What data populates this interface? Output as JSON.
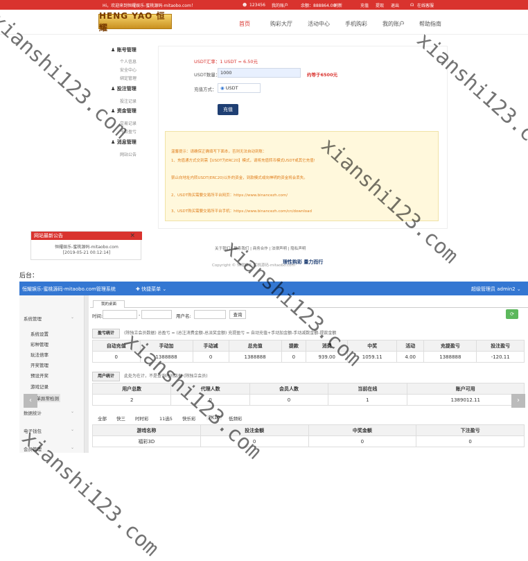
{
  "topbar": {
    "welcome": "Hi，欢迎来到恒耀娱乐-蜜桃源码-mitaobo.com！",
    "user": "123456",
    "account": "我的账户",
    "balance": "余额：888864.00",
    "refresh": "刷新",
    "recharge": "充值",
    "withdraw": "提现",
    "logout": "退出",
    "service": "在线客服"
  },
  "logo": {
    "text": "HENG YAO 恒耀"
  },
  "nav": [
    "首页",
    "购彩大厅",
    "活动中心",
    "手机购彩",
    "我的账户",
    "帮助指南"
  ],
  "sidebar": {
    "account_title": "账号管理",
    "account_items": [
      "个人信息",
      "安全中心",
      "绑定管理"
    ],
    "bet_title": "投注管理",
    "bet_items": [
      "投注记录"
    ],
    "funds_title": "资金管理",
    "funds_items": [
      "交易记录",
      "今日盈亏"
    ],
    "msg_title": "消息管理",
    "msg_items": [
      "网站公告"
    ]
  },
  "recharge": {
    "rate": "USDT汇率：1 USDT = 6.50元",
    "amount_label": "USDT数量：",
    "amount_value": "1000",
    "equiv": "约等于6500元",
    "method_label": "充值方式：",
    "method_value": "USDT",
    "submit": "充值"
  },
  "notice": {
    "l1": "温馨提示：请确保正确填写下面本，否则无法自动到账：",
    "l2": "1、充值通方式交到需【USDT为ERC20】模式，请将充值转币模式USDT或其它充值!",
    "l3": "禁止向地址内转USDT(ERC20)以外的资金，到款模式或向神明的资金将会丢失。",
    "l4": "2、USDT购买需要交易所平台网页：https://www.binancezh.com/",
    "l5": "3、USDT购买需要交易所平台手机：https://www.binancezh.com/cn/download"
  },
  "announce": {
    "title": "网站最新公告",
    "close": "×",
    "line1": "恒耀娱乐-蜜桃源码-mitaobo.com",
    "line2": "[2019-05-21 00:12:14]"
  },
  "footer": {
    "links": "关于我们 | 联系我们 | 商务合作 | 法律声明 | 隐私声明",
    "copyright": "Copyright © 恒耀娱乐-蜜桃源码-mitaobo.com",
    "slogan": "理性购彩 量力而行"
  },
  "backend": {
    "label": "后台：",
    "title": "恒耀娱乐-蜜桃源码-mitaobo.com管理系统",
    "quick": "✚ 快捷菜单 ⌄",
    "admin": "超级管理员  admin2 ⌄",
    "menu": {
      "sys": "系统管理",
      "items": [
        "系统设置",
        "彩种管理",
        "玩法倍率",
        "开奖管理",
        "预设开奖",
        "游戏记录",
        "注单异常检测"
      ],
      "data": "数据统计",
      "elec": "电子钱包",
      "member": "会员管理"
    },
    "tab": "我的桌面",
    "filter": {
      "time": "时间:",
      "dash": "-",
      "user": "用户名:",
      "query": "查询"
    },
    "profit": {
      "head": "盈亏统计",
      "note": "(除独立会员数据)  总盈亏 = (总注消费金额-总派奖金额)    充提盈亏 = 自动充值+手动加金额-手动减数金额-提款金额",
      "cols": [
        "自动充值",
        "手动加",
        "手动减",
        "总充值",
        "提款",
        "消费",
        "中奖",
        "活动",
        "充提盈亏",
        "投注盈亏"
      ],
      "row": [
        "0",
        "1388888",
        "0",
        "1388888",
        "0",
        "939.00",
        "1059.11",
        "4.00",
        "1388888",
        "-120.11"
      ]
    },
    "users": {
      "head": "用户统计",
      "note": "此处为在计，不是查询时间数据 (除独立会员)",
      "cols": [
        "用户总数",
        "代理人数",
        "会员人数",
        "当前在线",
        "账户可用"
      ],
      "row": [
        "2",
        "0",
        "0",
        "1",
        "1389012.11"
      ]
    },
    "games": {
      "tabs": [
        "全部",
        "快三",
        "时时彩",
        "11选5",
        "快乐彩",
        "PK10",
        "低频彩"
      ],
      "cols": [
        "游戏名称",
        "投注金额",
        "中奖金额",
        "下注盈亏"
      ],
      "row": [
        "福彩3D",
        "0",
        "0",
        "0"
      ]
    }
  },
  "watermark": "xianshi123.com"
}
